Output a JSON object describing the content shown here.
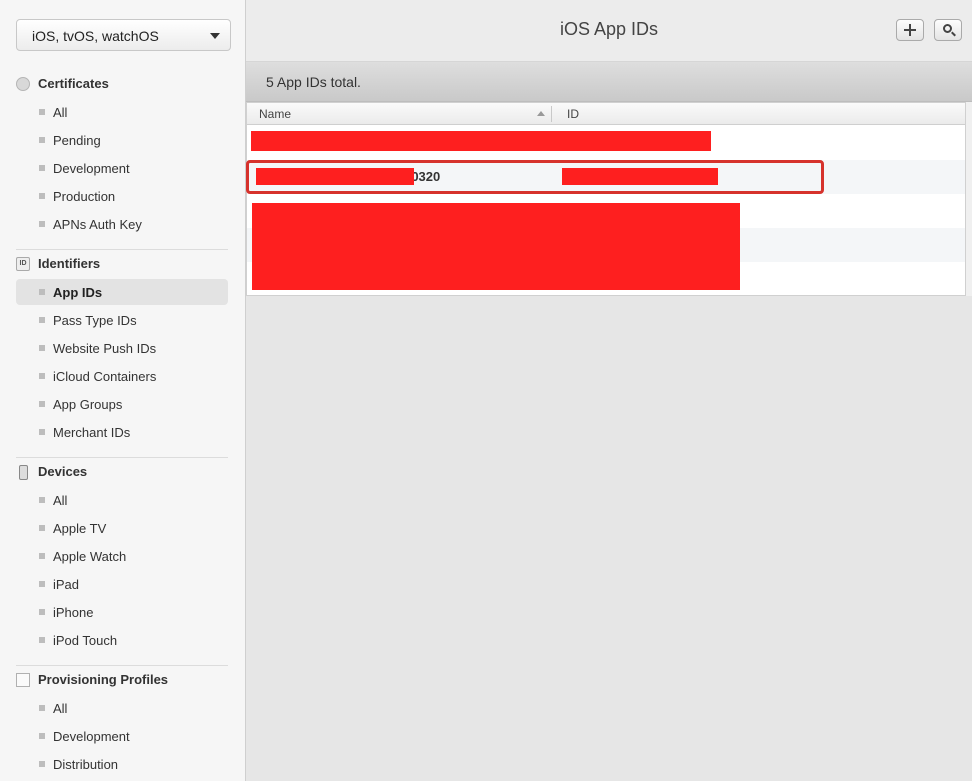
{
  "platform": {
    "selected": "iOS, tvOS, watchOS"
  },
  "sidebar": {
    "sections": [
      {
        "title": "Certificates",
        "icon": "certificate-badge-icon",
        "items": [
          "All",
          "Pending",
          "Development",
          "Production",
          "APNs Auth Key"
        ]
      },
      {
        "title": "Identifiers",
        "icon": "id-icon",
        "items": [
          "App IDs",
          "Pass Type IDs",
          "Website Push IDs",
          "iCloud Containers",
          "App Groups",
          "Merchant IDs"
        ]
      },
      {
        "title": "Devices",
        "icon": "device-icon",
        "items": [
          "All",
          "Apple TV",
          "Apple Watch",
          "iPad",
          "iPhone",
          "iPod Touch"
        ]
      },
      {
        "title": "Provisioning Profiles",
        "icon": "document-icon",
        "items": [
          "All",
          "Development",
          "Distribution"
        ]
      }
    ],
    "active_item": "App IDs"
  },
  "header": {
    "title": "iOS App IDs",
    "add_icon": "plus-icon",
    "search_icon": "search-icon"
  },
  "summary": {
    "count_text": "5  App IDs total."
  },
  "table": {
    "columns": [
      "Name",
      "ID"
    ],
    "rows": [
      {
        "name": "",
        "id": ""
      },
      {
        "name": "t0320",
        "id": ""
      },
      {
        "name": "",
        "id": ""
      },
      {
        "name": "",
        "id": ""
      },
      {
        "name": "",
        "id": ""
      }
    ]
  },
  "colors": {
    "redaction": "#fe1f1f",
    "highlight_border": "#d6322c",
    "row_alt": "#f4f6f8"
  }
}
